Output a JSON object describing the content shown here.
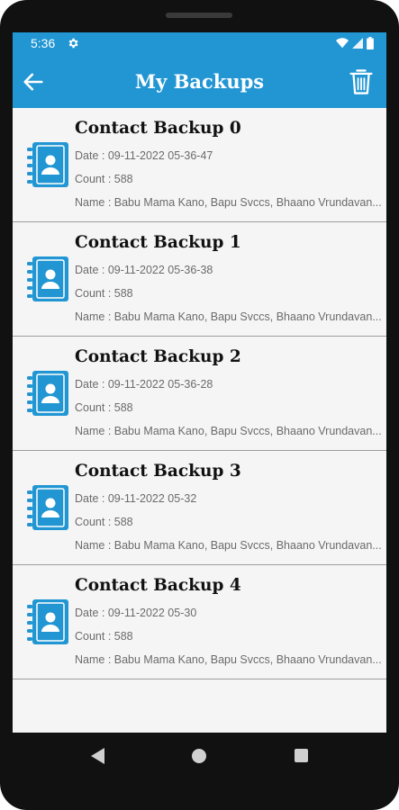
{
  "status": {
    "time": "5:36",
    "icons": [
      "gear-icon",
      "wifi-icon",
      "signal-icon",
      "battery-icon"
    ]
  },
  "appbar": {
    "title": "My Backups",
    "back_icon": "arrow-left-icon",
    "delete_icon": "trash-icon"
  },
  "colors": {
    "primary": "#2196d3",
    "list_background": "#f5f5f5",
    "divider": "#9e9e9e"
  },
  "backups": [
    {
      "title": "Contact Backup 0",
      "date": "Date : 09-11-2022 05-36-47",
      "count": "Count : 588",
      "names": "Name : Babu Mama Kano, Bapu Svccs, Bhaano Vrundavan..."
    },
    {
      "title": "Contact Backup 1",
      "date": "Date : 09-11-2022 05-36-38",
      "count": "Count : 588",
      "names": "Name : Babu Mama Kano, Bapu Svccs, Bhaano Vrundavan..."
    },
    {
      "title": "Contact Backup 2",
      "date": "Date : 09-11-2022 05-36-28",
      "count": "Count : 588",
      "names": "Name : Babu Mama Kano, Bapu Svccs, Bhaano Vrundavan..."
    },
    {
      "title": "Contact Backup 3",
      "date": "Date : 09-11-2022 05-32",
      "count": "Count : 588",
      "names": "Name : Babu Mama Kano, Bapu Svccs, Bhaano Vrundavan..."
    },
    {
      "title": "Contact Backup 4",
      "date": "Date : 09-11-2022 05-30",
      "count": "Count : 588",
      "names": "Name : Babu Mama Kano, Bapu Svccs, Bhaano Vrundavan..."
    }
  ],
  "navbar": {
    "icons": [
      "nav-back-icon",
      "nav-home-icon",
      "nav-recents-icon"
    ]
  }
}
